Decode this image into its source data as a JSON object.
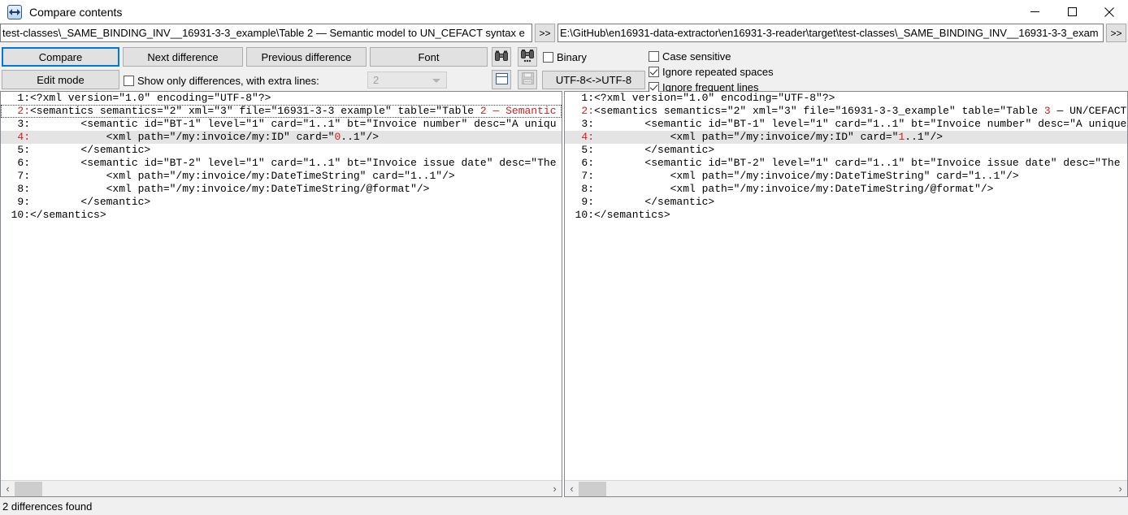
{
  "window": {
    "title": "Compare contents",
    "icon": "compare-arrows-icon",
    "minimize_label": "—",
    "maximize_label": "□",
    "close_label": "✕"
  },
  "paths": {
    "left_value": "test-classes\\_SAME_BINDING_INV__16931-3-3_example\\Table 2 — Semantic model to UN_CEFACT syntax e",
    "left_browse_label": ">>",
    "right_value": "E:\\GitHub\\en16931-data-extractor\\en16931-3-reader\\target\\test-classes\\_SAME_BINDING_INV__16931-3-3_exam",
    "right_browse_label": ">>"
  },
  "toolbar": {
    "compare_label": "Compare",
    "next_difference_label": "Next difference",
    "previous_difference_label": "Previous difference",
    "font_label": "Font",
    "edit_mode_label": "Edit mode",
    "find_icon": "binoculars-icon",
    "find_next_icon": "binoculars-next-icon",
    "view_icon": "window-pane-icon",
    "save_icon": "floppy-disk-icon",
    "encoding_label": "UTF-8<->UTF-8",
    "show_only_differences_label": "Show only differences, with extra lines:",
    "show_only_differences_checked": false,
    "extra_lines_value": "2",
    "binary_label": "Binary",
    "binary_checked": false,
    "case_sensitive_label": "Case sensitive",
    "case_sensitive_checked": false,
    "ignore_repeated_spaces_label": "Ignore repeated spaces",
    "ignore_repeated_spaces_checked": true,
    "ignore_frequent_lines_label": "Ignore frequent lines",
    "ignore_frequent_lines_checked": true
  },
  "left_pane": {
    "lines": [
      {
        "n": "1",
        "diff": false,
        "highlight": false,
        "focus": false,
        "parts": [
          {
            "t": "<?xml version=\"1.0\" encoding=\"UTF-8\"?>",
            "d": false
          }
        ]
      },
      {
        "n": "2",
        "diff": true,
        "highlight": false,
        "focus": true,
        "parts": [
          {
            "t": "<semantics semantics=\"2\" xml=\"3\" file=\"16931-3-3 example\" table=\"Table ",
            "d": false
          },
          {
            "t": "2 — Semantic",
            "d": true
          }
        ]
      },
      {
        "n": "3",
        "diff": false,
        "highlight": false,
        "focus": false,
        "parts": [
          {
            "t": "        <semantic id=\"BT-1\" level=\"1\" card=\"1..1\" bt=\"Invoice number\" desc=\"A uniqu",
            "d": false
          }
        ]
      },
      {
        "n": "4",
        "diff": true,
        "highlight": true,
        "focus": false,
        "parts": [
          {
            "t": "            <xml path=\"/my:invoice/my:ID\" card=\"",
            "d": false
          },
          {
            "t": "0",
            "d": true
          },
          {
            "t": "..1\"/>",
            "d": false
          }
        ]
      },
      {
        "n": "5",
        "diff": false,
        "highlight": false,
        "focus": false,
        "parts": [
          {
            "t": "        </semantic>",
            "d": false
          }
        ]
      },
      {
        "n": "6",
        "diff": false,
        "highlight": false,
        "focus": false,
        "parts": [
          {
            "t": "        <semantic id=\"BT-2\" level=\"1\" card=\"1..1\" bt=\"Invoice issue date\" desc=\"The",
            "d": false
          }
        ]
      },
      {
        "n": "7",
        "diff": false,
        "highlight": false,
        "focus": false,
        "parts": [
          {
            "t": "            <xml path=\"/my:invoice/my:DateTimeString\" card=\"1..1\"/>",
            "d": false
          }
        ]
      },
      {
        "n": "8",
        "diff": false,
        "highlight": false,
        "focus": false,
        "parts": [
          {
            "t": "            <xml path=\"/my:invoice/my:DateTimeString/@format\"/>",
            "d": false
          }
        ]
      },
      {
        "n": "9",
        "diff": false,
        "highlight": false,
        "focus": false,
        "parts": [
          {
            "t": "        </semantic>",
            "d": false
          }
        ]
      },
      {
        "n": "10",
        "diff": false,
        "highlight": false,
        "focus": false,
        "parts": [
          {
            "t": "</semantics>",
            "d": false
          }
        ]
      }
    ]
  },
  "right_pane": {
    "lines": [
      {
        "n": "1",
        "diff": false,
        "highlight": false,
        "focus": false,
        "parts": [
          {
            "t": "<?xml version=\"1.0\" encoding=\"UTF-8\"?>",
            "d": false
          }
        ]
      },
      {
        "n": "2",
        "diff": true,
        "highlight": false,
        "focus": false,
        "parts": [
          {
            "t": "<semantics semantics=\"2\" xml=\"3\" file=\"16931-3-3_example\" table=\"Table ",
            "d": false
          },
          {
            "t": "3",
            "d": true
          },
          {
            "t": " — UN/CEFACT",
            "d": false
          }
        ]
      },
      {
        "n": "3",
        "diff": false,
        "highlight": false,
        "focus": false,
        "parts": [
          {
            "t": "        <semantic id=\"BT-1\" level=\"1\" card=\"1..1\" bt=\"Invoice number\" desc=\"A unique",
            "d": false
          }
        ]
      },
      {
        "n": "4",
        "diff": true,
        "highlight": true,
        "focus": false,
        "parts": [
          {
            "t": "            <xml path=\"/my:invoice/my:ID\" card=\"",
            "d": false
          },
          {
            "t": "1",
            "d": true
          },
          {
            "t": "..1\"/>",
            "d": false
          }
        ]
      },
      {
        "n": "5",
        "diff": false,
        "highlight": false,
        "focus": false,
        "parts": [
          {
            "t": "        </semantic>",
            "d": false
          }
        ]
      },
      {
        "n": "6",
        "diff": false,
        "highlight": false,
        "focus": false,
        "parts": [
          {
            "t": "        <semantic id=\"BT-2\" level=\"1\" card=\"1..1\" bt=\"Invoice issue date\" desc=\"The",
            "d": false
          }
        ]
      },
      {
        "n": "7",
        "diff": false,
        "highlight": false,
        "focus": false,
        "parts": [
          {
            "t": "            <xml path=\"/my:invoice/my:DateTimeString\" card=\"1..1\"/>",
            "d": false
          }
        ]
      },
      {
        "n": "8",
        "diff": false,
        "highlight": false,
        "focus": false,
        "parts": [
          {
            "t": "            <xml path=\"/my:invoice/my:DateTimeString/@format\"/>",
            "d": false
          }
        ]
      },
      {
        "n": "9",
        "diff": false,
        "highlight": false,
        "focus": false,
        "parts": [
          {
            "t": "        </semantic>",
            "d": false
          }
        ]
      },
      {
        "n": "10",
        "diff": false,
        "highlight": false,
        "focus": false,
        "parts": [
          {
            "t": "</semantics>",
            "d": false
          }
        ]
      }
    ]
  },
  "scrollbars": {
    "left_arrow_label": "‹",
    "right_arrow_label": "›"
  },
  "status": {
    "text": "2 differences found"
  },
  "colors": {
    "diff_red": "#d02020",
    "focus_blue": "#0078d7",
    "highlight_gray": "#e4e4e4",
    "chrome_gray": "#f0f0f0"
  }
}
